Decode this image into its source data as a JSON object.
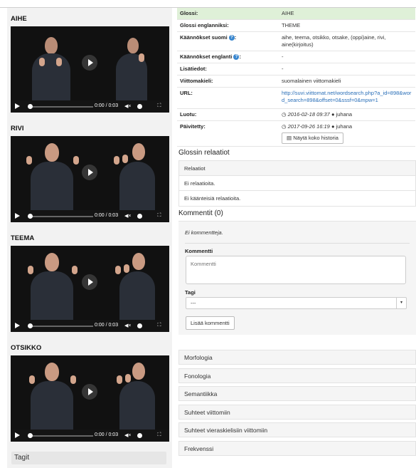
{
  "videos": [
    {
      "title": "AIHE",
      "time": "0:00 / 0:03"
    },
    {
      "title": "RIVI",
      "time": "0:00 / 0:03"
    },
    {
      "title": "TEEMA",
      "time": "0:00 / 0:03"
    },
    {
      "title": "OTSIKKO",
      "time": "0:00 / 0:03"
    }
  ],
  "tags_heading": "Tagit",
  "info": {
    "gloss_label": "Glossi:",
    "gloss_value": "AIHE",
    "gloss_en_label": "Glossi englanniksi:",
    "gloss_en_value": "THEME",
    "trans_fi_label": "Käännökset suomi",
    "trans_fi_value": "aihe, teema, otsikko, otsake, (oppi)aine, rivi, aine(kirjoitus)",
    "trans_en_label": "Käännökset englanti",
    "trans_en_value": "-",
    "extra_label": "Lisätiedot:",
    "extra_value": "-",
    "lang_label": "Viittomakieli:",
    "lang_value": "suomalainen viittomakieli",
    "url_label": "URL:",
    "url_value": "http://suvi.viittomat.net/wordsearch.php?a_id=898&word_search=898&offset=0&sssf=0&mpw=1",
    "created_label": "Luotu:",
    "created_date": "2016-02-18 09:37",
    "created_user": "juhana",
    "updated_label": "Päivitetty:",
    "updated_date": "2017-09-26 16:19",
    "updated_user": "juhana",
    "history_button": "Näytä koko historia"
  },
  "relations": {
    "heading": "Glossin relaatiot",
    "header": "Relaatiot",
    "none": "Ei relaatioita.",
    "none_reverse": "Ei käänteisiä relaatioita."
  },
  "comments": {
    "heading": "Kommentit (0)",
    "empty": "Ei kommentteja.",
    "comment_label": "Kommentti",
    "comment_placeholder": "Kommentti",
    "tag_label": "Tagi",
    "tag_selected": "---",
    "add_button": "Lisää kommentti"
  },
  "accordion": [
    "Morfologia",
    "Fonologia",
    "Semantiikka",
    "Suhteet viittomiin",
    "Suhteet vieraskielisiin viittomiin",
    "Frekvenssi"
  ],
  "colors": {
    "gloss_row": "#dff0d8",
    "link": "#2a6fb8",
    "help_icon": "#3a87cf"
  }
}
